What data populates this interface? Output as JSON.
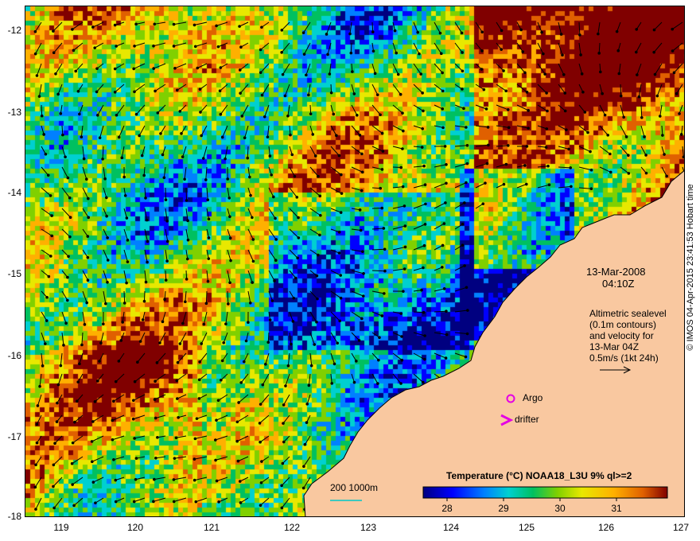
{
  "map": {
    "lat_ticks": [
      "-12",
      "-13",
      "-14",
      "-15",
      "-16",
      "-17",
      "-18"
    ],
    "lon_ticks": [
      "119",
      "120",
      "121",
      "122",
      "123",
      "124",
      "125",
      "126",
      "127"
    ],
    "date_label": "13-Mar-2008",
    "time_label": "04:10Z",
    "note_lines": [
      "Altimetric sealevel",
      "(0.1m contours)",
      "and velocity for",
      "13-Mar 04Z",
      "0.5m/s (1kt 24h)"
    ],
    "argo_label": "Argo",
    "drifter_label": "drifter",
    "depth_label": "200  1000m",
    "legend_title": "Temperature (°C) NOAA18_L3U 9% ql>=2",
    "legend_ticks": [
      "28",
      "29",
      "30",
      "31"
    ],
    "credit": "© IMOS 04-Apr-2015 23:41:53 Hobart time",
    "colors": {
      "land": "#f9c8a0",
      "argo_marker": "#e400e4",
      "drifter_marker": "#e400e4",
      "depth_line_200": "#00c8c8",
      "colorbar": [
        "#000080",
        "#0000ff",
        "#0080ff",
        "#00d0d0",
        "#00c060",
        "#80d000",
        "#e8e800",
        "#ffb000",
        "#e06000",
        "#800000"
      ]
    }
  }
}
